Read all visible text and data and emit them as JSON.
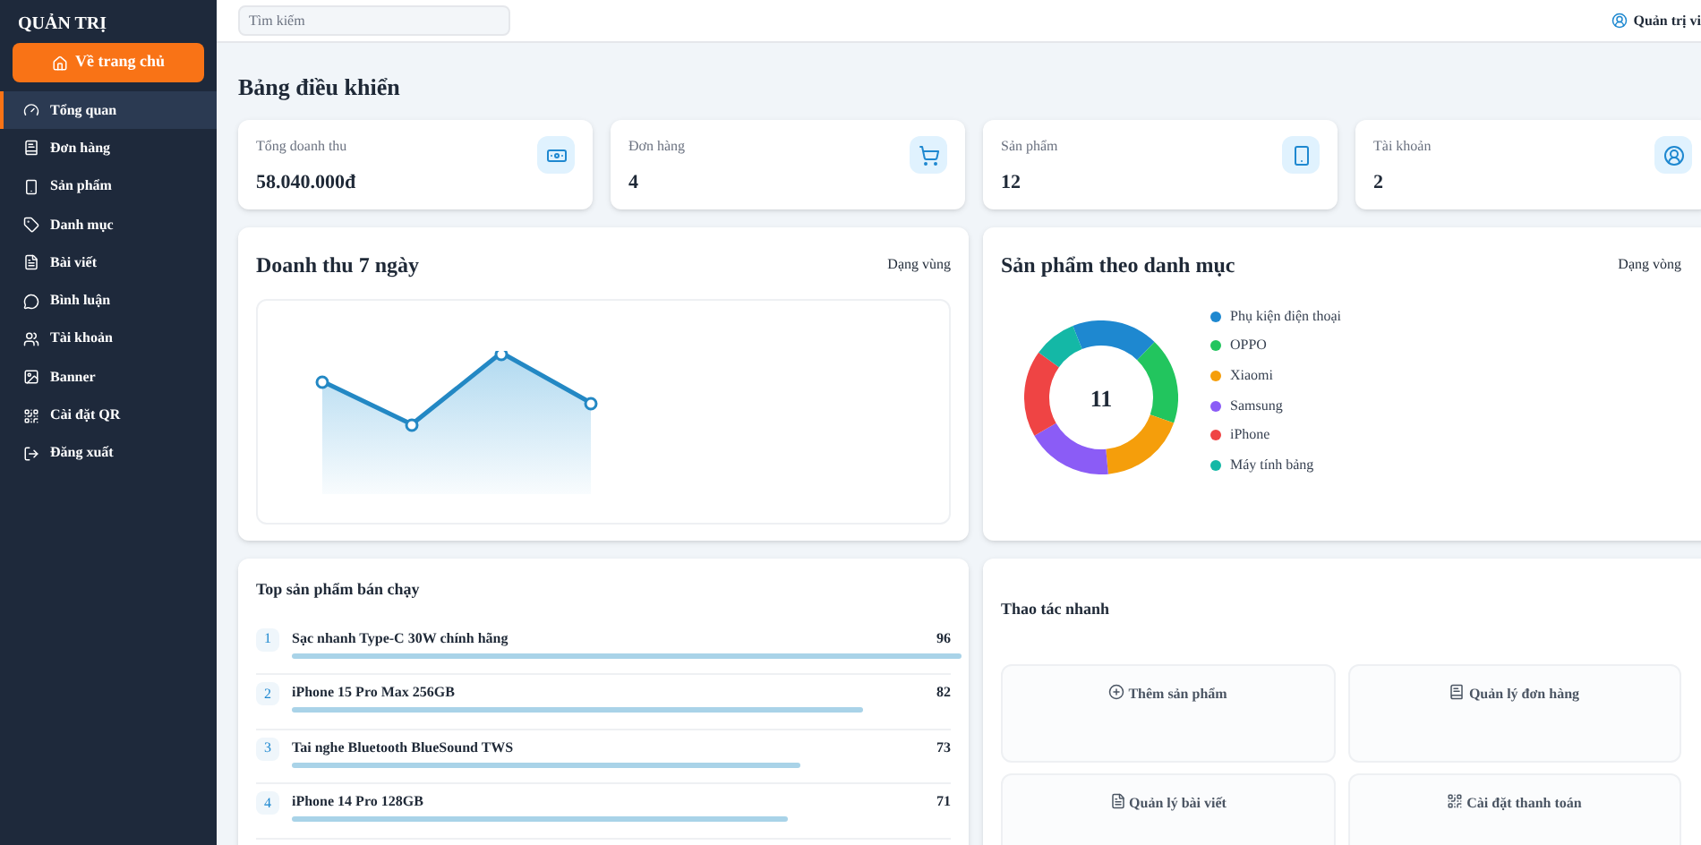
{
  "sidebar": {
    "title": "QUẢN TRỊ",
    "home_button": "Về trang chủ",
    "items": [
      {
        "label": "Tổng quan",
        "selected": true
      },
      {
        "label": "Đơn hàng",
        "selected": false
      },
      {
        "label": "Sản phẩm",
        "selected": false
      },
      {
        "label": "Danh mục",
        "selected": false
      },
      {
        "label": "Bài viết",
        "selected": false
      },
      {
        "label": "Bình luận",
        "selected": false
      },
      {
        "label": "Tài khoản",
        "selected": false
      },
      {
        "label": "Banner",
        "selected": false
      },
      {
        "label": "Cài đặt QR",
        "selected": false
      },
      {
        "label": "Đăng xuất",
        "selected": false
      }
    ]
  },
  "header": {
    "search": {
      "placeholder": "Tìm kiếm"
    },
    "user": "Quản trị vi"
  },
  "page_title": "Bảng điều khiển",
  "stats": [
    {
      "label": "Tổng doanh thu",
      "value": "58.040.000đ"
    },
    {
      "label": "Đơn hàng",
      "value": "4"
    },
    {
      "label": "Sản phẩm",
      "value": "12"
    },
    {
      "label": "Tài khoản",
      "value": "2"
    }
  ],
  "revenue_card": {
    "title": "Doanh thu 7 ngày",
    "mode": "Dạng vùng"
  },
  "category_card": {
    "title": "Sản phẩm theo danh mục",
    "mode": "Dạng vòng",
    "total": "11",
    "legend": [
      {
        "label": "Phụ kiện điện thoại",
        "color": "#1e88d0"
      },
      {
        "label": "OPPO",
        "color": "#22c55e"
      },
      {
        "label": "Xiaomi",
        "color": "#f59e0b"
      },
      {
        "label": "Samsung",
        "color": "#8b5cf6"
      },
      {
        "label": "iPhone",
        "color": "#ef4444"
      },
      {
        "label": "Máy tính bảng",
        "color": "#14b8a6"
      }
    ]
  },
  "top_products": {
    "title": "Top sản phẩm bán chạy",
    "rows": [
      {
        "rank": "1",
        "name": "Sạc nhanh Type-C 30W chính hãng",
        "value": "96"
      },
      {
        "rank": "2",
        "name": "iPhone 15 Pro Max 256GB",
        "value": "82"
      },
      {
        "rank": "3",
        "name": "Tai nghe Bluetooth BlueSound TWS",
        "value": "73"
      },
      {
        "rank": "4",
        "name": "iPhone 14 Pro 128GB",
        "value": "71"
      }
    ]
  },
  "quick_actions": {
    "title": "Thao tác nhanh",
    "buttons": [
      {
        "label": "Thêm sản phẩm"
      },
      {
        "label": "Quản lý đơn hàng"
      },
      {
        "label": "Quản lý bài viết"
      },
      {
        "label": "Cài đặt thanh toán"
      }
    ]
  }
}
